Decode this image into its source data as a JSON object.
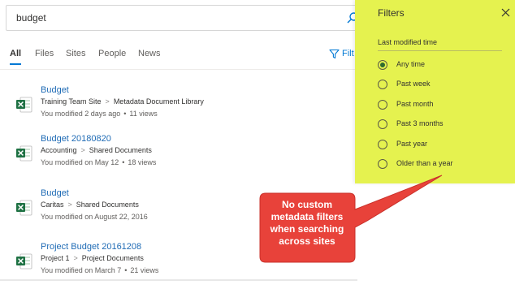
{
  "search": {
    "value": "budget"
  },
  "tabs": [
    {
      "label": "All",
      "active": true
    },
    {
      "label": "Files"
    },
    {
      "label": "Sites"
    },
    {
      "label": "People"
    },
    {
      "label": "News"
    }
  ],
  "filter_button": {
    "label": "Filt"
  },
  "results": [
    {
      "title": "Budget",
      "path": [
        "Training Team Site",
        "Metadata Document Library"
      ],
      "modified": "You modified 2 days ago",
      "views": "11 views",
      "icon": "excel-icon"
    },
    {
      "title": "Budget 20180820",
      "path": [
        "Accounting",
        "Shared Documents"
      ],
      "modified": "You modified on May 12",
      "views": "18 views",
      "icon": "excel-icon"
    },
    {
      "title": "Budget",
      "path": [
        "Caritas",
        "Shared Documents"
      ],
      "modified": "You modified on August 22, 2016",
      "views": "",
      "icon": "excel-icon"
    },
    {
      "title": "Project Budget 20161208",
      "path": [
        "Project 1",
        "Project Documents"
      ],
      "modified": "You modified on March 7",
      "views": "21 views",
      "icon": "excel-icon"
    }
  ],
  "panel": {
    "title": "Filters",
    "section": "Last modified time",
    "options": [
      {
        "label": "Any time",
        "checked": true
      },
      {
        "label": "Past week",
        "checked": false
      },
      {
        "label": "Past month",
        "checked": false
      },
      {
        "label": "Past 3 months",
        "checked": false
      },
      {
        "label": "Past year",
        "checked": false
      },
      {
        "label": "Older than a year",
        "checked": false
      }
    ],
    "background": "#e5f24f"
  },
  "callout": {
    "lines": [
      "No custom",
      "metadata filters",
      "when searching",
      "across sites"
    ],
    "color": "#e8423a"
  }
}
